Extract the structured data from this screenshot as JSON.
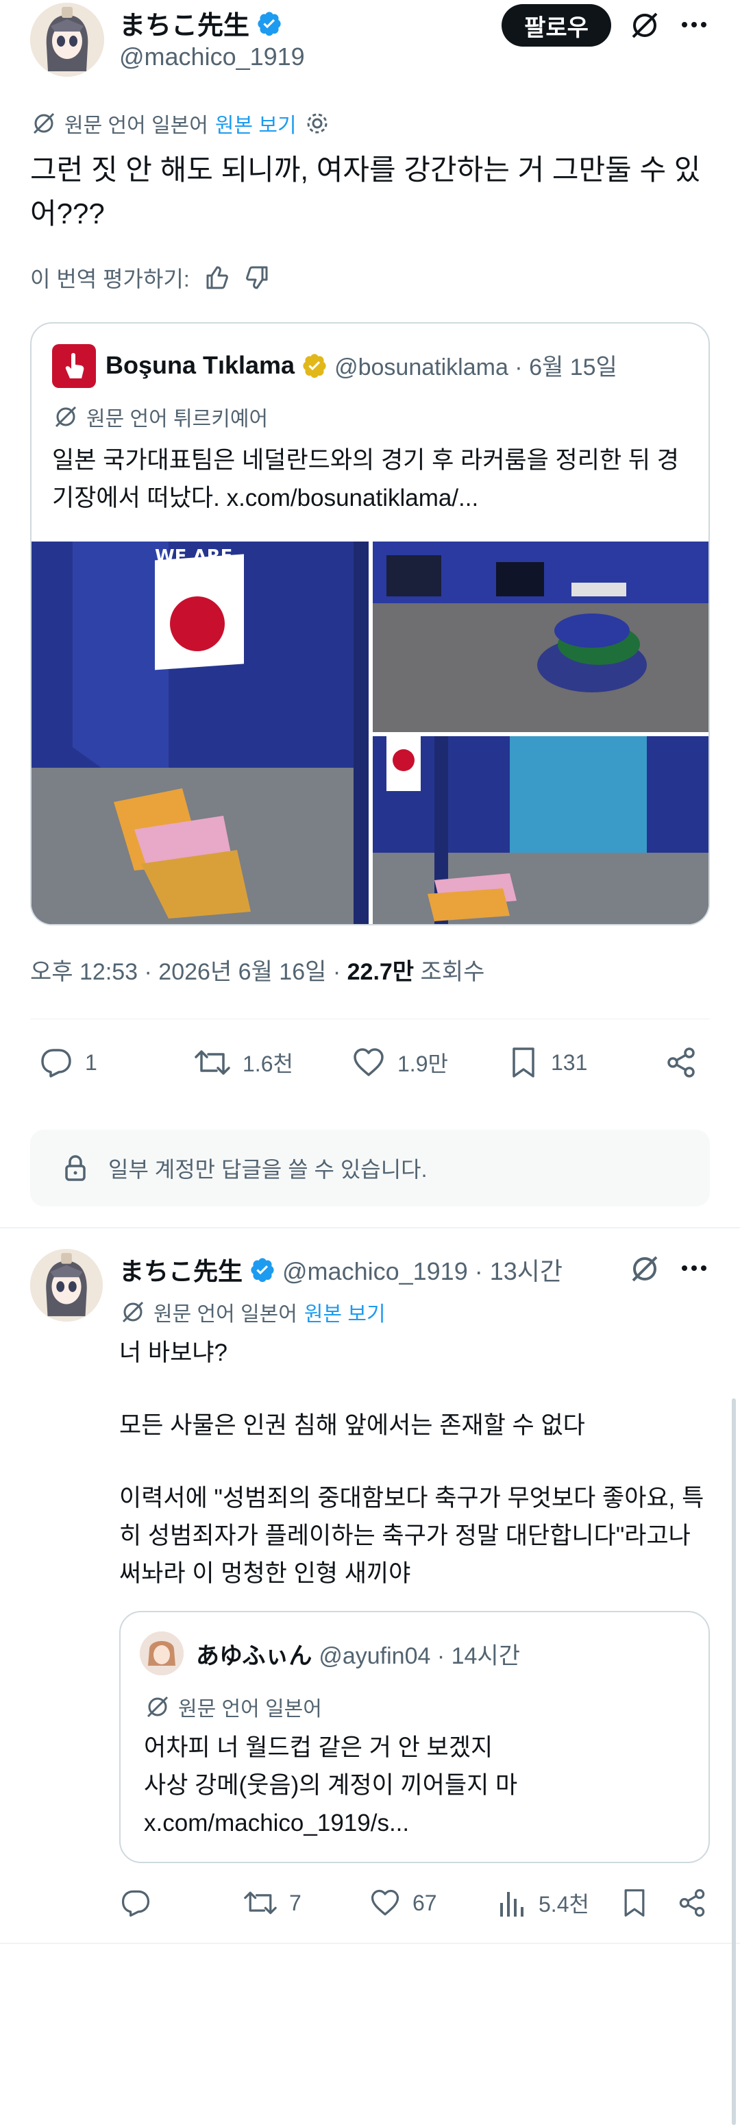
{
  "main": {
    "author_name": "まちこ先生",
    "author_handle": "@machico_1919",
    "follow_label": "팔로우",
    "translate_note": "원문 언어 일본어",
    "show_original": "원본 보기",
    "text": "그런 짓 안 해도 되니까, 여자를 강간하는 거 그만둘 수 있어???",
    "rate_translation": "이 번역 평가하기:",
    "timestamp": "오후 12:53 · 2026년 6월 16일 · ",
    "views_count": "22.7만",
    "views_label": " 조회수",
    "replies": "1",
    "reposts": "1.6천",
    "likes": "1.9만",
    "bookmarks": "131",
    "reply_restriction": "일부 계정만 답글을 쓸 수 있습니다."
  },
  "quoted": {
    "name": "Boşuna Tıklama",
    "meta": "@bosunatiklama · 6월 15일",
    "translate_note": "원문 언어 튀르키예어",
    "text": "일본 국가대표팀은 네덜란드와의 경기 후 라커룸을 정리한 뒤 경기장에서 떠났다. x.com/bosunatiklama/..."
  },
  "reply": {
    "author_name": "まちこ先生",
    "meta": "@machico_1919 · 13시간",
    "translate_note": "원문 언어 일본어",
    "show_original": "원본 보기",
    "line1": "너 바보냐?",
    "line2": "모든 사물은 인권 침해 앞에서는 존재할 수 없다",
    "line3": "이력서에 \"성범죄의 중대함보다 축구가 무엇보다 좋아요, 특히 성범죄자가 플레이하는 축구가 정말 대단합니다\"라고나 써놔라 이 멍청한 인형 새끼야",
    "replies": "",
    "reposts": "7",
    "likes": "67",
    "views": "5.4천"
  },
  "reply_quoted": {
    "name": "あゆふぃん",
    "meta": "@ayufin04 · 14시간",
    "translate_note": "원문 언어 일본어",
    "line1": "어차피 너 월드컵 같은 거 안 보겠지",
    "line2": "사상 강메(웃음)의 계정이 끼어들지 마",
    "line3": "x.com/machico_1919/s..."
  },
  "photos": {
    "left_text": "WE ARE"
  },
  "colors": {
    "accent": "#1d9bf0",
    "text": "#0f1419",
    "muted": "#536471",
    "border": "#cfd9de",
    "verified": "#1d9bf0",
    "verified_gold": "#e2b719"
  }
}
